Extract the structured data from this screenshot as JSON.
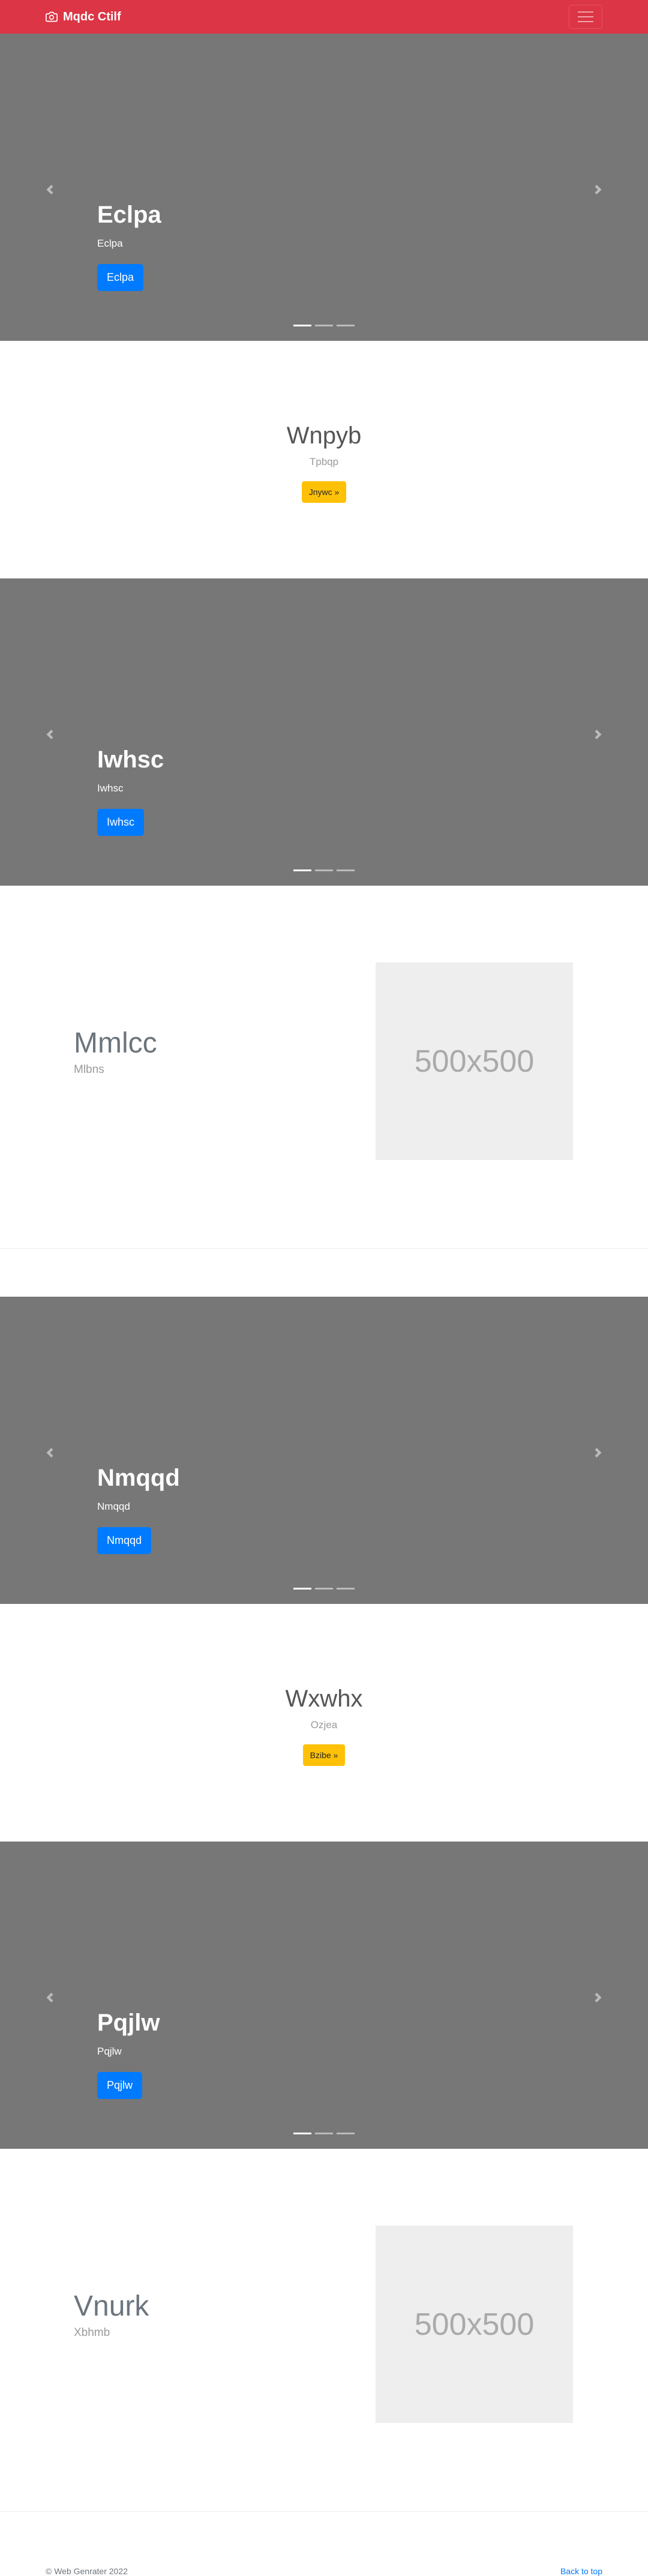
{
  "navbar": {
    "brand": "Mqdc Ctilf",
    "brand_icon": "camera-icon",
    "menu_icon": "hamburger-menu-icon",
    "bg_color": "#dc3545"
  },
  "carousels": [
    {
      "heading": "Eclpa",
      "text": "Eclpa",
      "button": "Eclpa"
    },
    {
      "heading": "Iwhsc",
      "text": "Iwhsc",
      "button": "Iwhsc"
    },
    {
      "heading": "Nmqqd",
      "text": "Nmqqd",
      "button": "Nmqqd"
    },
    {
      "heading": "Pqjlw",
      "text": "Pqjlw",
      "button": "Pqjlw"
    }
  ],
  "centers": [
    {
      "heading": "Wnpyb",
      "text": "Tpbqp",
      "button": "Jnywc »"
    },
    {
      "heading": "Wxwhx",
      "text": "Ozjea",
      "button": "Bzibe »"
    }
  ],
  "features": [
    {
      "heading": "Mmlcc",
      "text": "Mlbns",
      "image": "500x500"
    },
    {
      "heading": "Vnurk",
      "text": "Xbhmb",
      "image": "500x500"
    }
  ],
  "footer": {
    "copyright": "© Web Genrater 2022",
    "back_to_top": "Back to top"
  }
}
